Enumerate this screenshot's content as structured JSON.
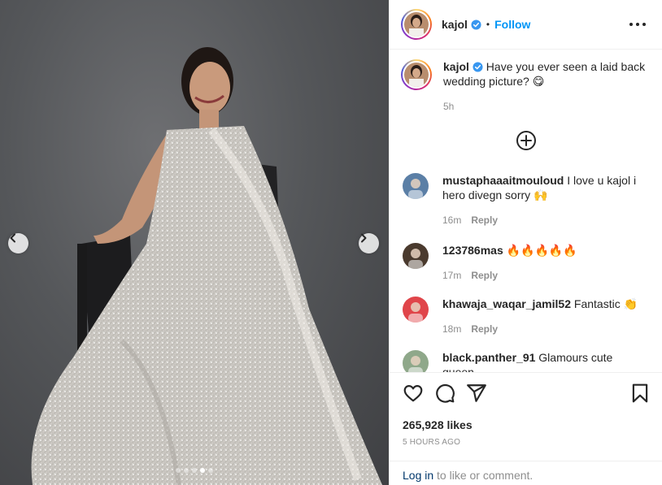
{
  "post": {
    "author": "kajol",
    "separator": "•",
    "follow_label": "Follow",
    "caption_text": "Have you ever seen a laid back wedding picture? 😋",
    "caption_age": "5h",
    "likes": "265,928 likes",
    "posted_ago": "5 HOURS AGO",
    "carousel": {
      "slide_count": 5,
      "active_index": 3
    }
  },
  "comments": [
    {
      "username": "mustaphaaaitmouloud",
      "text": "I love u kajol i hero divegn sorry 🙌",
      "age": "16m",
      "reply_label": "Reply",
      "avatar_color": "#5b7fa6"
    },
    {
      "username": "123786mas",
      "text": "🔥🔥🔥🔥🔥",
      "age": "17m",
      "reply_label": "Reply",
      "avatar_color": "#4a3a2e"
    },
    {
      "username": "khawaja_waqar_jamil52",
      "text": "Fantastic 👏",
      "age": "18m",
      "reply_label": "Reply",
      "avatar_color": "#e0454a"
    },
    {
      "username": "black.panther_91",
      "text": "Glamours cute queen",
      "age": "",
      "reply_label": "",
      "avatar_color": "#8fa88a"
    }
  ],
  "footer": {
    "login_link": "Log in",
    "login_rest": " to like or comment."
  },
  "icons": {
    "prev": "chevron-left-icon",
    "next": "chevron-right-icon",
    "verified": "verified-badge-icon",
    "more": "more-options-icon",
    "add": "add-circle-icon",
    "like": "heart-icon",
    "comment": "comment-icon",
    "share": "share-icon",
    "save": "bookmark-icon"
  },
  "colors": {
    "link_blue": "#0095f6",
    "verified_blue": "#3897f0",
    "muted": "#8e8e8e"
  }
}
